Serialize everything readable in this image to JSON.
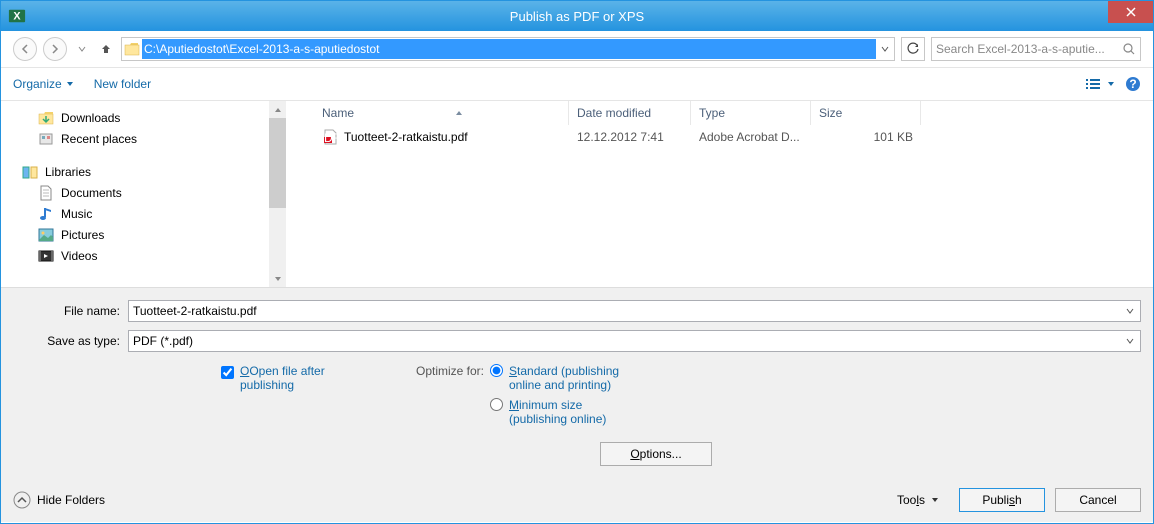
{
  "window": {
    "title": "Publish as PDF or XPS"
  },
  "nav": {
    "path": "C:\\Aputiedostot\\Excel-2013-a-s-aputiedostot",
    "search_placeholder": "Search Excel-2013-a-s-aputie..."
  },
  "toolbar": {
    "organize": "Organize",
    "newfolder": "New folder"
  },
  "sidebar": {
    "downloads": "Downloads",
    "recent": "Recent places",
    "libraries": "Libraries",
    "documents": "Documents",
    "music": "Music",
    "pictures": "Pictures",
    "videos": "Videos"
  },
  "columns": {
    "name": "Name",
    "date": "Date modified",
    "type": "Type",
    "size": "Size"
  },
  "files": [
    {
      "name": "Tuotteet-2-ratkaistu.pdf",
      "date": "12.12.2012 7:41",
      "type": "Adobe Acrobat D...",
      "size": "101 KB"
    }
  ],
  "form": {
    "filename_label": "File name:",
    "filename_value": "Tuotteet-2-ratkaistu.pdf",
    "savetype_label": "Save as type:",
    "savetype_value": "PDF (*.pdf)",
    "openafter_pre": "Open file after",
    "openafter_post": "publishing",
    "optimize_label": "Optimize for:",
    "opt_standard": "Standard (publishing online and printing)",
    "opt_minimum": "Minimum size (publishing online)",
    "options_btn": "Options..."
  },
  "footer": {
    "hide": "Hide Folders",
    "tools": "Tools",
    "publish": "Publish",
    "cancel": "Cancel"
  }
}
